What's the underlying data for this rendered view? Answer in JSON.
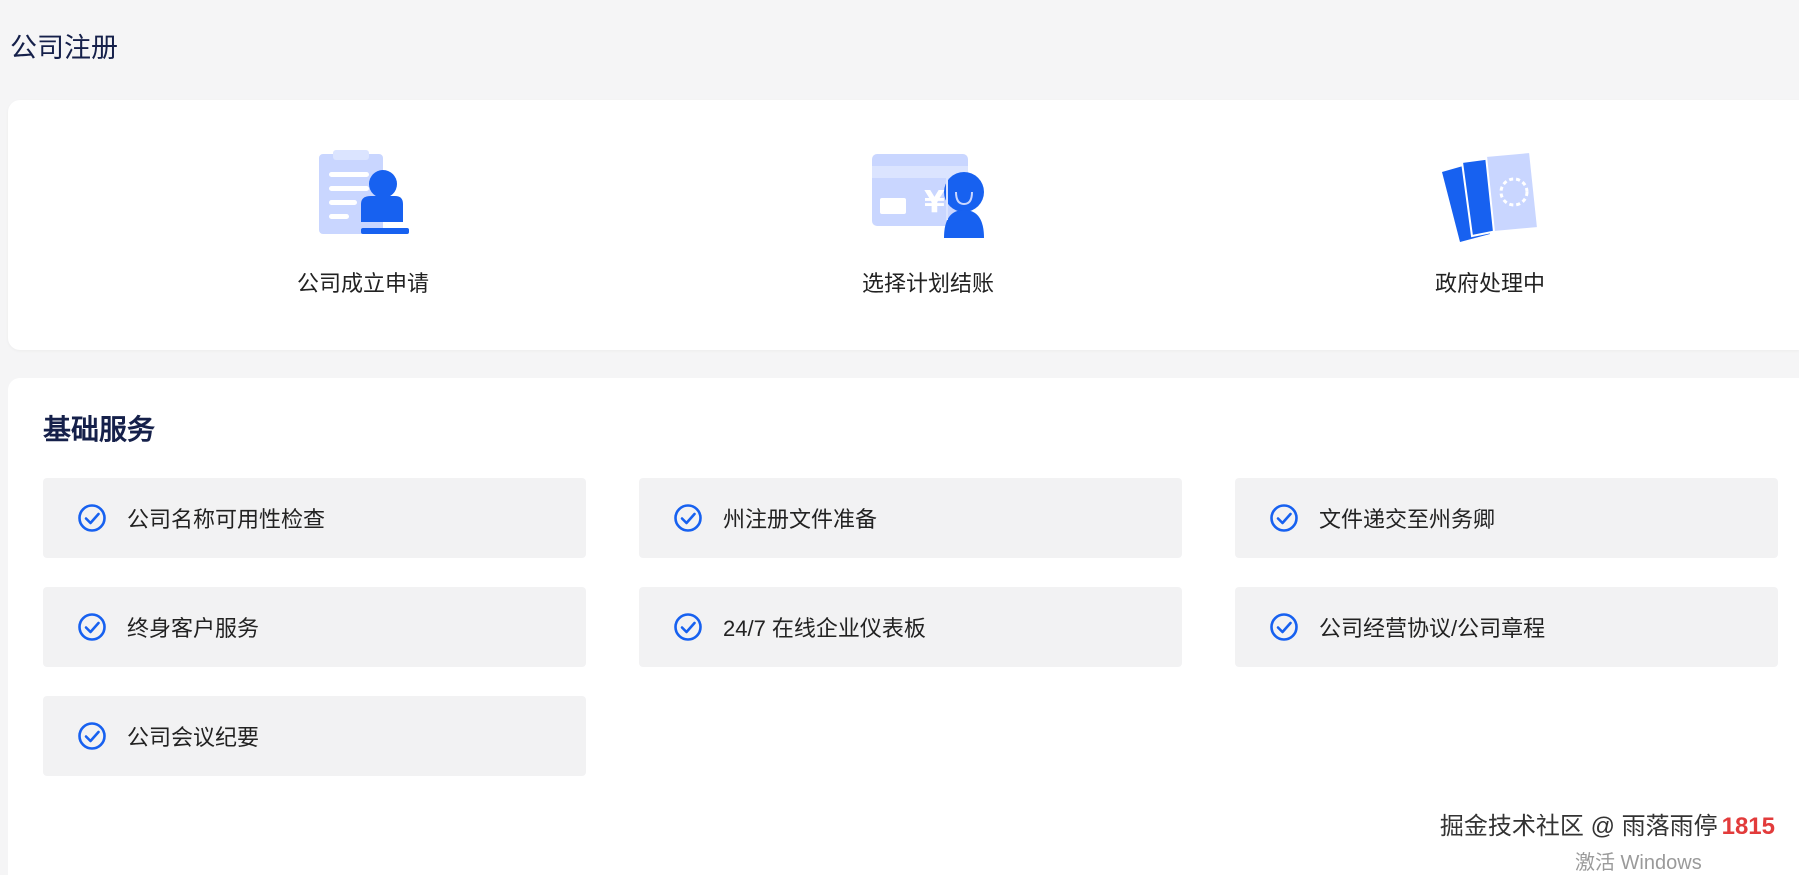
{
  "page": {
    "title": "公司注册"
  },
  "steps": [
    {
      "label": "公司成立申请",
      "icon": "clipboard-person-icon"
    },
    {
      "label": "选择计划结账",
      "icon": "card-yen-person-icon"
    },
    {
      "label": "政府处理中",
      "icon": "documents-stack-icon"
    }
  ],
  "services": {
    "title": "基础服务",
    "items": [
      {
        "label": "公司名称可用性检查"
      },
      {
        "label": "州注册文件准备"
      },
      {
        "label": "文件递交至州务卿"
      },
      {
        "label": "终身客户服务"
      },
      {
        "label": "24/7 在线企业仪表板"
      },
      {
        "label": "公司经营协议/公司章程"
      },
      {
        "label": "公司会议纪要"
      }
    ]
  },
  "watermark": {
    "text": "掘金技术社区 @ 雨落雨停",
    "number": "1815"
  },
  "os_overlay": {
    "text": "激活 Windows"
  },
  "colors": {
    "accent": "#1761f0",
    "accent_light": "#c9d6ff",
    "title": "#15204a",
    "item_bg": "#f2f2f3",
    "page_bg": "#f5f5f6"
  }
}
